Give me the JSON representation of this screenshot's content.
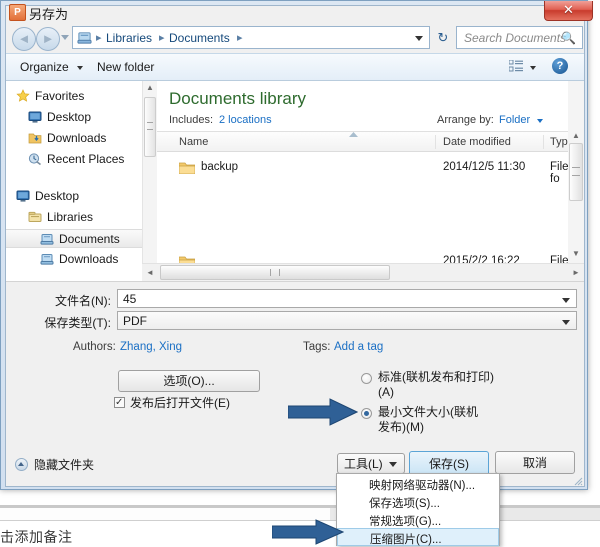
{
  "background": {
    "notes_text": "击添加备注"
  },
  "dialog": {
    "title": "另存为",
    "title_icon": "powerpoint-p-icon",
    "close_label": "✕",
    "nav": {
      "back_icon": "arrow-left-icon",
      "forward_icon": "arrow-right-icon",
      "breadcrumb_icon": "library-icon",
      "breadcrumbs": [
        "Libraries",
        "Documents"
      ],
      "separator": "▸",
      "refresh_icon": "refresh-icon",
      "search_placeholder": "Search Documents",
      "search_value": "",
      "search_icon": "magnifier-icon"
    },
    "toolbar": {
      "organize_label": "Organize",
      "new_folder_label": "New folder",
      "view_icon": "list-view-icon",
      "help_icon": "help-question-icon",
      "help_label": "?"
    },
    "navpane": {
      "items": [
        {
          "label": "Favorites",
          "icon": "star-icon",
          "indent": 10,
          "selected": false
        },
        {
          "label": "Desktop",
          "icon": "monitor-icon",
          "indent": 22,
          "selected": false
        },
        {
          "label": "Downloads",
          "icon": "download-icon",
          "indent": 22,
          "selected": false
        },
        {
          "label": "Recent Places",
          "icon": "recent-icon",
          "indent": 22,
          "selected": false
        },
        {
          "label": "Desktop",
          "icon": "monitor-icon",
          "indent": 10,
          "selected": false
        },
        {
          "label": "Libraries",
          "icon": "libraries-icon",
          "indent": 22,
          "selected": false
        },
        {
          "label": "Documents",
          "icon": "documents-icon",
          "indent": 34,
          "selected": true
        },
        {
          "label": "Downloads",
          "icon": "documents-icon",
          "indent": 34,
          "selected": false
        }
      ],
      "scroll_up_icon": "caret-up-icon",
      "scroll_down_icon": "caret-down-icon"
    },
    "listpane": {
      "library_title": "Documents library",
      "includes_label": "Includes:",
      "includes_value": "2 locations",
      "arrange_label": "Arrange by:",
      "arrange_value": "Folder",
      "columns": [
        "Name",
        "Date modified",
        "Type"
      ],
      "rows": [
        {
          "name": "backup",
          "date": "2014/12/5 11:30",
          "type": "File fo",
          "icon": "folder-icon"
        },
        {
          "name": "",
          "date": "2015/2/2 16:22",
          "type": "File fo",
          "icon": "folder-icon"
        }
      ],
      "sort_indicator": "caret-up-icon"
    },
    "form": {
      "filename_label": "文件名(N):",
      "filename_value": "45",
      "savetype_label": "保存类型(T):",
      "savetype_value": "PDF",
      "authors_label": "Authors:",
      "authors_value": "Zhang, Xing",
      "tags_label": "Tags:",
      "tags_value": "Add a tag",
      "options_button": "选项(O)...",
      "open_after_label": "发布后打开文件(E)",
      "open_after_checked": true,
      "check_glyph": "✓",
      "radios": [
        {
          "label": "标准(联机发布和打印)(A)",
          "selected": false
        },
        {
          "label": "最小文件大小(联机发布)(M)",
          "selected": true
        }
      ]
    },
    "footer": {
      "hide_folders_label": "隐藏文件夹",
      "hide_folders_icon": "caret-up-circle-icon",
      "tools_label": "工具(L)",
      "save_label": "保存(S)",
      "cancel_label": "取消"
    },
    "tools_menu": {
      "items": [
        {
          "label": "映射网络驱动器(N)...",
          "highlighted": false
        },
        {
          "label": "保存选项(S)...",
          "highlighted": false
        },
        {
          "label": "常规选项(G)...",
          "highlighted": false
        },
        {
          "label": "压缩图片(C)...",
          "highlighted": true
        }
      ]
    },
    "annotations": [
      {
        "name": "arrow-to-min-size-radio",
        "target": "最小文件大小(联机发布)(M)"
      },
      {
        "name": "arrow-to-compress-pictures",
        "target": "压缩图片(C)..."
      }
    ]
  },
  "colors": {
    "accent_blue": "#1a6fc4",
    "library_green": "#2e6b2e",
    "arrow_blue": "#2a5f96",
    "close_red": "#c83b2c",
    "highlight_blue": "#dff0fb"
  }
}
